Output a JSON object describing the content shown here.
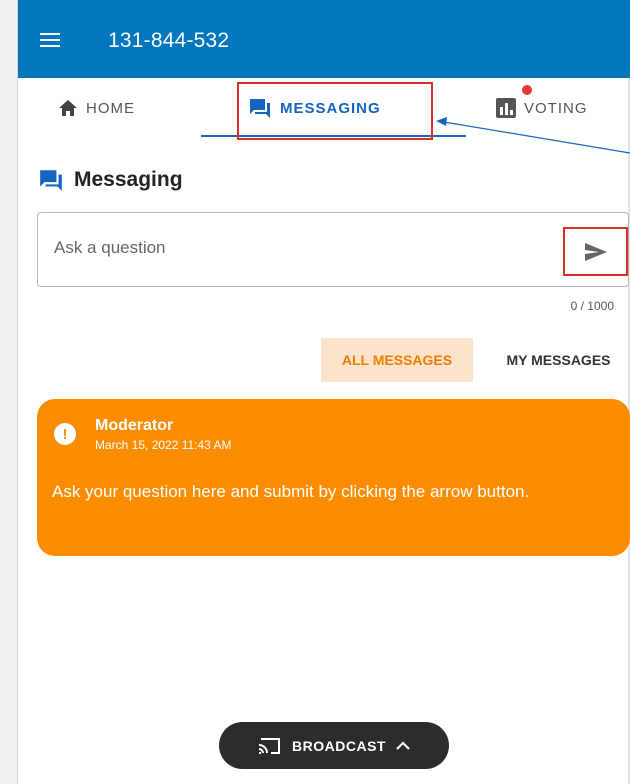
{
  "header": {
    "title": "131-844-532"
  },
  "tabs": [
    {
      "label": "HOME",
      "icon": "home-icon"
    },
    {
      "label": "MESSAGING",
      "icon": "chat-icon",
      "active": true
    },
    {
      "label": "VOTING",
      "icon": "bar-chart-icon",
      "notification_dot": true
    }
  ],
  "messaging": {
    "title": "Messaging",
    "input": {
      "placeholder": "Ask a question",
      "value": ""
    },
    "counter": "0 / 1000",
    "filters": {
      "all": "ALL MESSAGES",
      "mine": "MY MESSAGES"
    }
  },
  "messages": [
    {
      "author": "Moderator",
      "time": "March 15, 2022 11:43 AM",
      "body": "Ask your question here and submit by clicking the arrow button."
    }
  ],
  "broadcast": {
    "label": "BROADCAST"
  },
  "colors": {
    "app_bar": "#0277bd",
    "accent": "#1565c0",
    "message_card": "#fb8c00",
    "filter_active_bg": "#fde3cb",
    "annotation_red": "#d32f2f",
    "notification": "#e53935"
  }
}
